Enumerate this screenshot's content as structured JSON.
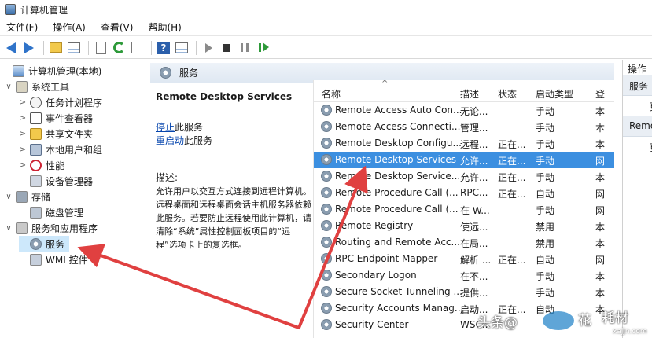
{
  "window": {
    "title": "计算机管理"
  },
  "menu": [
    "文件(F)",
    "操作(A)",
    "查看(V)",
    "帮助(H)"
  ],
  "toolbar": {
    "icons": [
      "back-arrow",
      "forward-arrow",
      "up-folder",
      "show-tree",
      "properties",
      "refresh",
      "export-list",
      "help",
      "show-pane",
      "start-service",
      "stop-service",
      "pause-service",
      "restart-service"
    ],
    "help_glyph": "?"
  },
  "tree": {
    "expand_open": "∨",
    "expand_closed": ">",
    "items": [
      {
        "label": "计算机管理(本地)",
        "icon": "computer-icon"
      },
      {
        "label": "系统工具",
        "icon": "tools-icon"
      },
      {
        "label": "任务计划程序",
        "icon": "clock-icon"
      },
      {
        "label": "事件查看器",
        "icon": "event-viewer-icon"
      },
      {
        "label": "共享文件夹",
        "icon": "shared-folder-icon"
      },
      {
        "label": "本地用户和组",
        "icon": "users-icon"
      },
      {
        "label": "性能",
        "icon": "performance-icon"
      },
      {
        "label": "设备管理器",
        "icon": "device-manager-icon"
      },
      {
        "label": "存储",
        "icon": "storage-icon"
      },
      {
        "label": "磁盘管理",
        "icon": "disk-icon"
      },
      {
        "label": "服务和应用程序",
        "icon": "services-apps-icon"
      },
      {
        "label": "服务",
        "icon": "gear-icon"
      },
      {
        "label": "WMI 控件",
        "icon": "wmi-icon"
      }
    ]
  },
  "services_panel": {
    "header": "服务",
    "selected_service": "Remote Desktop Services",
    "stop_link": "停止",
    "stop_suffix": "此服务",
    "restart_link": "重启动",
    "restart_suffix": "此服务",
    "desc_label": "描述:",
    "desc_text": "允许用户以交互方式连接到远程计算机。远程桌面和远程桌面会话主机服务器依赖此服务。若要防止远程使用此计算机，请清除“系统”属性控制面板项目的“远程”选项卡上的复选框。"
  },
  "list": {
    "sort_caret": "^",
    "columns": [
      "名称",
      "描述",
      "状态",
      "启动类型",
      "登"
    ],
    "rows": [
      {
        "name": "Remote Access Auto Con...",
        "desc": "无论...",
        "status": "",
        "startup": "手动",
        "logon": "本"
      },
      {
        "name": "Remote Access Connecti...",
        "desc": "管理...",
        "status": "",
        "startup": "手动",
        "logon": "本"
      },
      {
        "name": "Remote Desktop Configu...",
        "desc": "远程...",
        "status": "正在...",
        "startup": "手动",
        "logon": "本"
      },
      {
        "name": "Remote Desktop Services",
        "desc": "允许...",
        "status": "正在...",
        "startup": "手动",
        "logon": "网"
      },
      {
        "name": "Remote Desktop Service...",
        "desc": "允许...",
        "status": "正在...",
        "startup": "手动",
        "logon": "本"
      },
      {
        "name": "Remote Procedure Call (...",
        "desc": "RPC...",
        "status": "正在...",
        "startup": "自动",
        "logon": "网"
      },
      {
        "name": "Remote Procedure Call (...",
        "desc": "在 W...",
        "status": "",
        "startup": "手动",
        "logon": "网"
      },
      {
        "name": "Remote Registry",
        "desc": "使远...",
        "status": "",
        "startup": "禁用",
        "logon": "本"
      },
      {
        "name": "Routing and Remote Acc...",
        "desc": "在局...",
        "status": "",
        "startup": "禁用",
        "logon": "本"
      },
      {
        "name": "RPC Endpoint Mapper",
        "desc": "解析 ...",
        "status": "正在...",
        "startup": "自动",
        "logon": "网"
      },
      {
        "name": "Secondary Logon",
        "desc": "在不...",
        "status": "",
        "startup": "手动",
        "logon": "本"
      },
      {
        "name": "Secure Socket Tunneling ...",
        "desc": "提供...",
        "status": "",
        "startup": "手动",
        "logon": "本"
      },
      {
        "name": "Security Accounts Manag...",
        "desc": "启动...",
        "status": "正在...",
        "startup": "自动",
        "logon": "本"
      },
      {
        "name": "Security Center",
        "desc": "WSC...",
        "status": "",
        "startup": "",
        "logon": ""
      }
    ]
  },
  "actions": {
    "header": "操作",
    "section1": "服务",
    "section2": "Remote Desktop Services",
    "item1": "更",
    "item2": "更"
  },
  "watermark": {
    "text": "头条@",
    "text2": "花",
    "text3": "耗材",
    "url": "xajjn.com"
  },
  "colors": {
    "selection": "#3c8fe0",
    "annotation_arrow": "#e04040",
    "link": "#0645ad"
  }
}
